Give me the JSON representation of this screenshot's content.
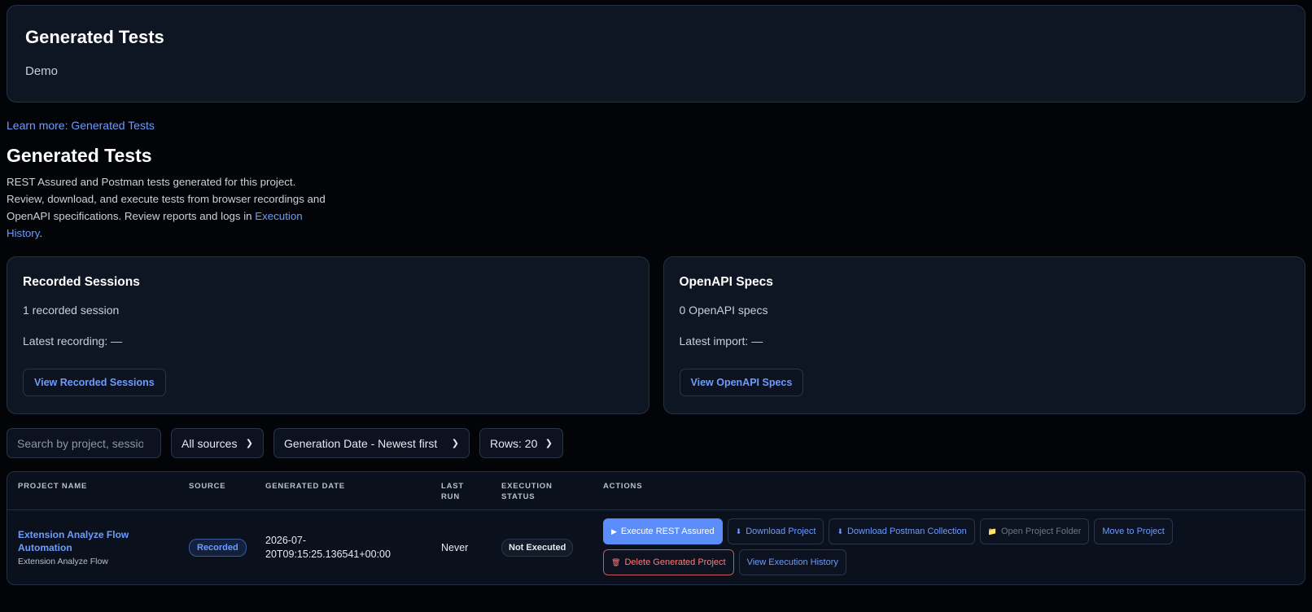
{
  "header": {
    "title": "Generated Tests",
    "subtitle": "Demo"
  },
  "learn_link": "Learn more: Generated Tests",
  "section": {
    "title": "Generated Tests",
    "intro_text": "REST Assured and Postman tests generated for this project. Review, download, and execute tests from browser recordings and OpenAPI specifications. Review reports and logs in ",
    "intro_link": "Execution History",
    "intro_end": "."
  },
  "cards": {
    "recorded": {
      "title": "Recorded Sessions",
      "count": "1 recorded session",
      "latest": "Latest recording: —",
      "button": "View Recorded Sessions"
    },
    "openapi": {
      "title": "OpenAPI Specs",
      "count": "0 OpenAPI specs",
      "latest": "Latest import: —",
      "button": "View OpenAPI Specs"
    }
  },
  "filters": {
    "search_placeholder": "Search by project, session",
    "source": "All sources",
    "sort": "Generation Date - Newest first",
    "rows": "Rows: 20"
  },
  "table": {
    "headers": {
      "project": "PROJECT NAME",
      "source": "SOURCE",
      "generated": "GENERATED DATE",
      "last_run_1": "LAST",
      "last_run_2": "RUN",
      "exec_1": "EXECUTION",
      "exec_2": "STATUS",
      "actions": "ACTIONS"
    },
    "rows": [
      {
        "project_name": "Extension Analyze Flow Automation",
        "project_sub": "Extension Analyze Flow",
        "source": "Recorded",
        "generated_1": "2026-07-",
        "generated_2": "20T09:15:25.136541+00:00",
        "last_run": "Never",
        "status": "Not Executed",
        "actions": {
          "execute": "Execute REST Assured",
          "download": "Download Project",
          "postman": "Download Postman Collection",
          "open_folder": "Open Project Folder",
          "move": "Move to Project",
          "delete": "Delete Generated Project",
          "history": "View Execution History"
        }
      }
    ]
  },
  "icons": {
    "play": "▶",
    "download": "⬇",
    "folder": "📁",
    "trash": "🗑"
  },
  "colors": {
    "accent": "#6c9cff",
    "primary_button": "#5b8dfa",
    "danger": "#ff7b7b",
    "card_bg": "#0f1623",
    "page_bg": "#020408"
  }
}
